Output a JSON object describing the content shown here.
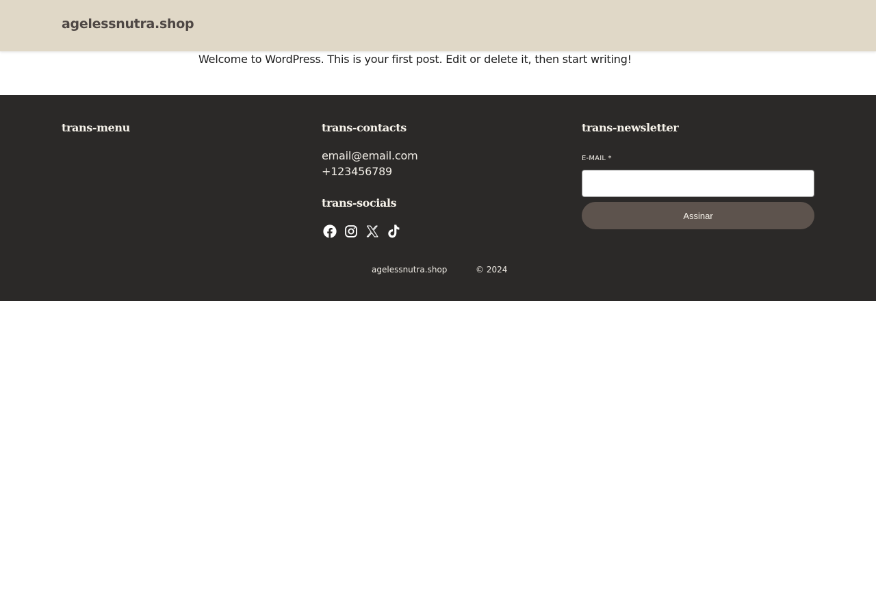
{
  "header": {
    "site_title": "agelessnutra.shop"
  },
  "main": {
    "post_text": "Welcome to WordPress. This is your first post. Edit or delete it, then start writing!"
  },
  "footer": {
    "menu_heading": "trans-menu",
    "contacts_heading": "trans-contacts",
    "contacts": {
      "email": "email@email.com",
      "phone": "+123456789"
    },
    "socials_heading": "trans-socials",
    "socials": [
      {
        "name": "Facebook",
        "icon": "facebook-icon"
      },
      {
        "name": "Instagram",
        "icon": "instagram-icon"
      },
      {
        "name": "X",
        "icon": "x-icon"
      },
      {
        "name": "TikTok",
        "icon": "tiktok-icon"
      }
    ],
    "newsletter_heading": "trans-newsletter",
    "newsletter": {
      "email_label": "E-MAIL *",
      "email_value": "",
      "submit_label": "Assinar"
    },
    "bottom": {
      "site_name": "agelessnutra.shop",
      "copyright": "© 2024"
    }
  },
  "colors": {
    "header_bg": "#e0d8c7",
    "footer_bg": "#2b2928",
    "button_bg": "#5d534d",
    "footer_text": "#f1ede6"
  }
}
